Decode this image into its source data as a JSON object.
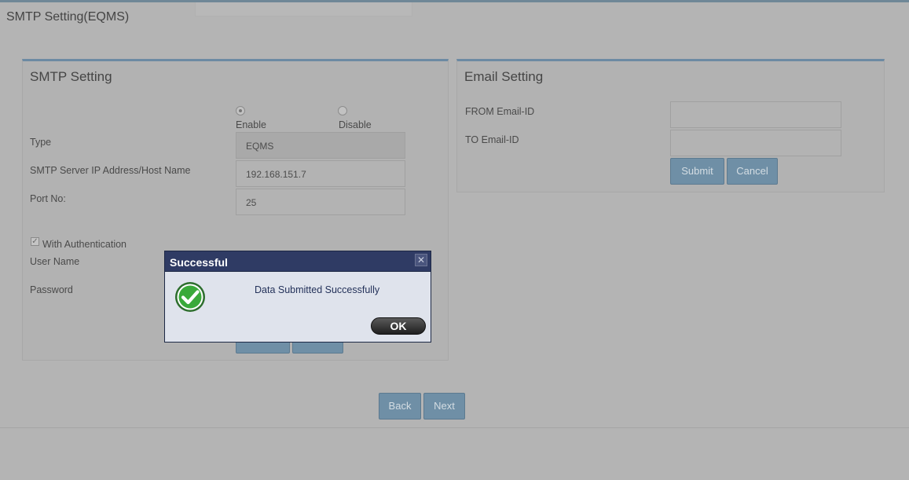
{
  "page": {
    "title": "SMTP Setting(EQMS)"
  },
  "smtp": {
    "title": "SMTP Setting",
    "radio": {
      "enable_label": "Enable",
      "disable_label": "Disable",
      "selected": "Enable"
    },
    "type_label": "Type",
    "type_value": "EQMS",
    "server_label": "SMTP Server IP Address/Host Name",
    "server_value": "192.168.151.7",
    "port_label": "Port No:",
    "port_value": "25",
    "auth_label": "With Authentication",
    "auth_checked": true,
    "username_label": "User Name",
    "password_label": "Password"
  },
  "email": {
    "title": "Email Setting",
    "from_label": "FROM Email-ID",
    "from_value": "",
    "to_label": "TO Email-ID",
    "to_value": "",
    "submit_label": "Submit",
    "cancel_label": "Cancel"
  },
  "nav": {
    "back_label": "Back",
    "next_label": "Next"
  },
  "dialog": {
    "title": "Successful",
    "message": "Data Submitted Successfully",
    "ok_label": "OK",
    "close_glyph": "✕",
    "icon": "success-check-icon"
  },
  "colors": {
    "accent": "#6c8aa3",
    "dialog_header": "#2f3b64",
    "success_green": "#3aa93a"
  }
}
